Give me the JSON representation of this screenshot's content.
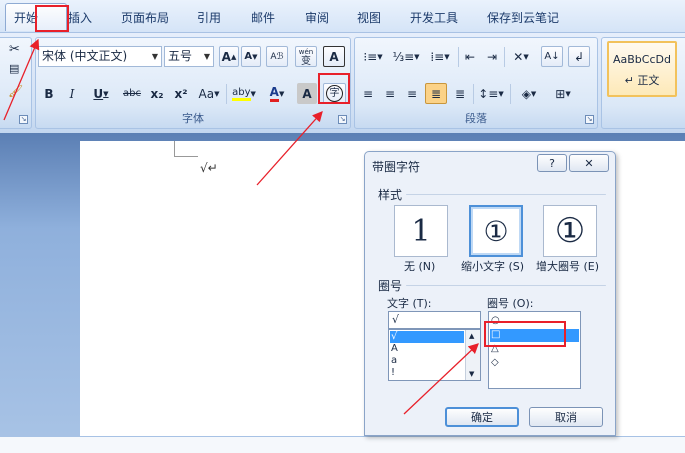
{
  "tabs": [
    "开始",
    "插入",
    "页面布局",
    "引用",
    "邮件",
    "审阅",
    "视图",
    "开发工具",
    "保存到云笔记"
  ],
  "font_group": {
    "font_name": "宋体 (中文正文)",
    "font_size": "五号",
    "label": "字体",
    "grow_label": "A",
    "shrink_label": "A",
    "phonetic_label": "wén",
    "phonetic_char": "变",
    "border_char_label": "A",
    "bold": "B",
    "italic": "I",
    "underline": "U",
    "strike": "abc",
    "subscript": "x₂",
    "superscript": "x²",
    "case": "Aa",
    "highlight": "aby",
    "font_color": "A",
    "shading": "A",
    "enclose_char": "字"
  },
  "paragraph_group": {
    "label": "段落"
  },
  "styles_group": {
    "sample": "AaBbCcDd",
    "name": "↵ 正文"
  },
  "document": {
    "text": "√↵"
  },
  "dialog": {
    "title": "带圈字符",
    "help": "?",
    "close": "✕",
    "style_section": "样式",
    "options": [
      {
        "label": "无 (N)",
        "glyph": "1"
      },
      {
        "label": "缩小文字 (S)",
        "glyph": "①"
      },
      {
        "label": "增大圈号 (E)",
        "glyph": "①"
      }
    ],
    "circle_section": "圈号",
    "text_label": "文字 (T):",
    "text_value": "√",
    "text_items": [
      "√",
      "A",
      "a",
      "!"
    ],
    "circle_label": "圈号 (O):",
    "circle_items": [
      "○",
      "□",
      "△",
      "◇"
    ],
    "ok": "确定",
    "cancel": "取消"
  },
  "colors": {
    "red_annotation": "#e8202a",
    "selection": "#3399ff"
  }
}
